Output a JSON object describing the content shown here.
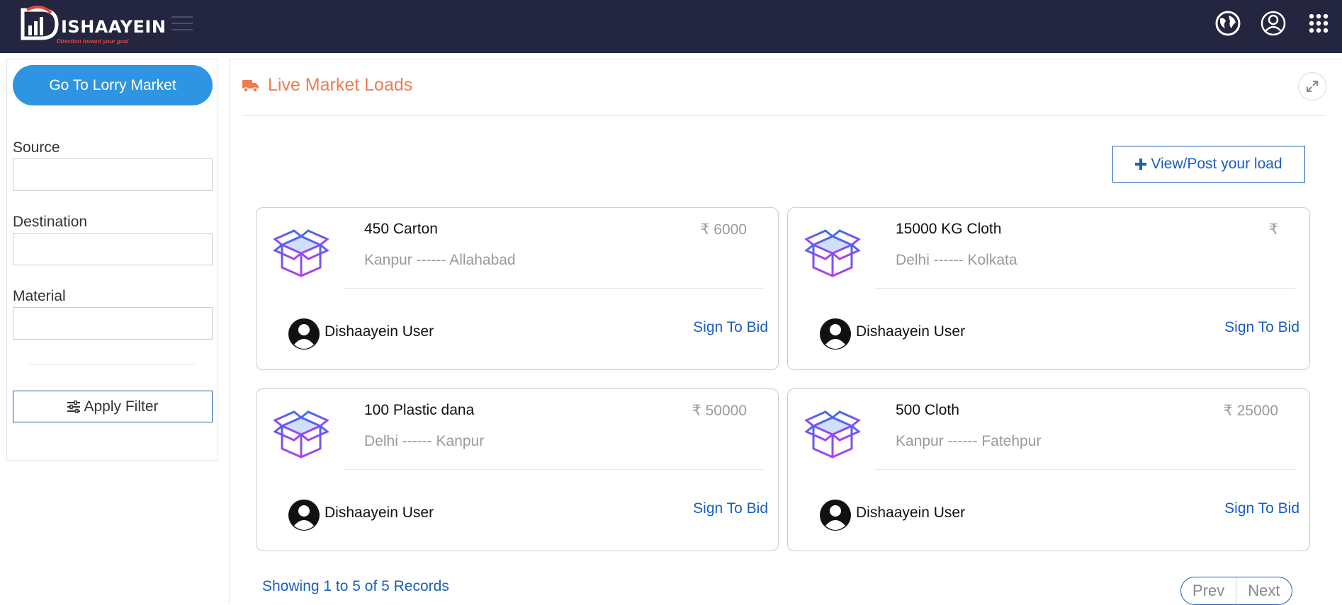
{
  "header": {
    "logo_text": "ISHAAYEIN",
    "logo_tagline": "Direction toward your goal",
    "icons": [
      "globe-icon",
      "user-circle-icon",
      "apps-grid-icon"
    ]
  },
  "sidebar": {
    "lorry_button": "Go To Lorry Market",
    "source_label": "Source",
    "source_value": "",
    "destination_label": "Destination",
    "destination_value": "",
    "material_label": "Material",
    "material_value": "",
    "apply_label": "Apply Filter"
  },
  "main": {
    "title": "Live Market Loads",
    "post_button": "View/Post your load",
    "loads": [
      {
        "qty": "450 Carton",
        "price": "₹ 6000",
        "route": "Kanpur ------ Allahabad",
        "user": "Dishaayein User",
        "action": "Sign To Bid"
      },
      {
        "qty": "15000 KG Cloth",
        "price": "₹",
        "route": "Delhi ------ Kolkata",
        "user": "Dishaayein User",
        "action": "Sign To Bid"
      },
      {
        "qty": "100 Plastic dana",
        "price": "₹ 50000",
        "route": "Delhi ------ Kanpur",
        "user": "Dishaayein User",
        "action": "Sign To Bid"
      },
      {
        "qty": "500 Cloth",
        "price": "₹ 25000",
        "route": "Kanpur ------ Fatehpur",
        "user": "Dishaayein User",
        "action": "Sign To Bid"
      }
    ],
    "records_text": "Showing 1 to 5 of 5 Records",
    "prev_label": "Prev",
    "next_label": "Next"
  },
  "colors": {
    "header_bg": "#24253f",
    "accent_blue": "#2e95e3",
    "link_blue": "#1a5fbd",
    "title_orange": "#f07b4f"
  }
}
